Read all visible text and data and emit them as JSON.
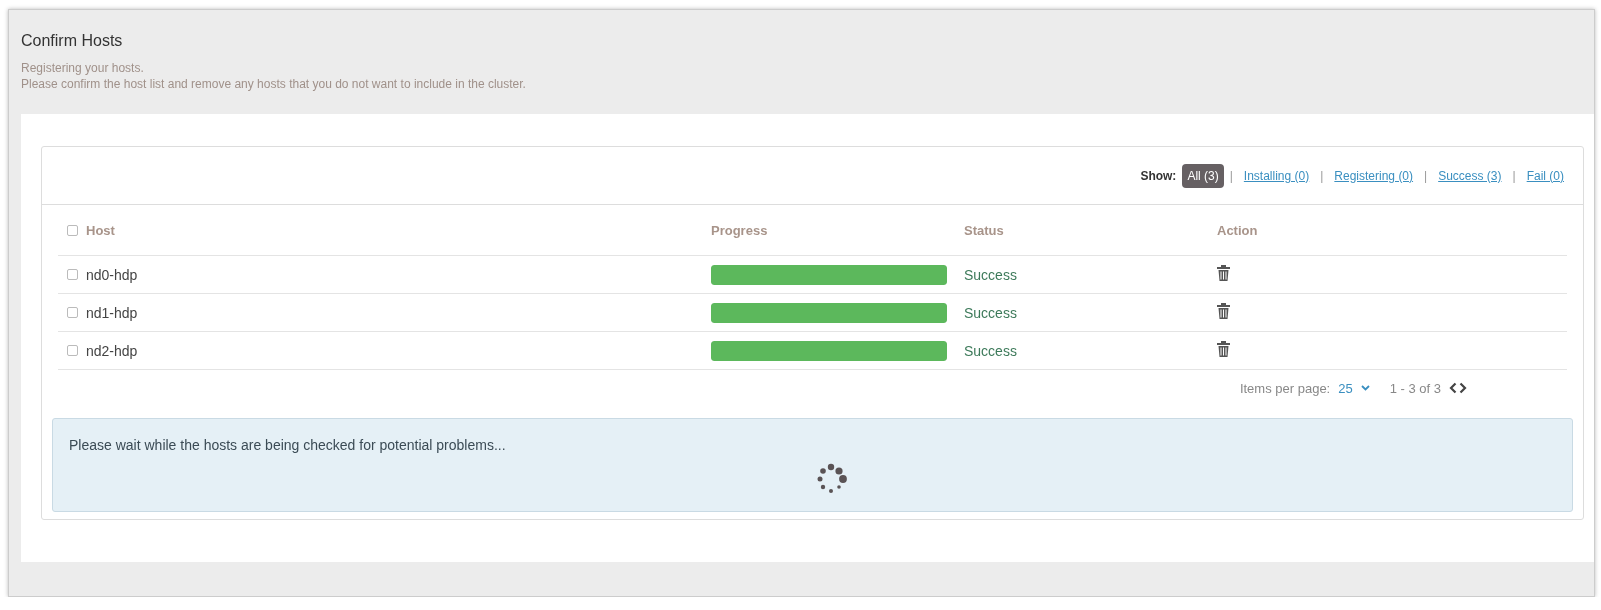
{
  "page": {
    "title": "Confirm Hosts",
    "subtitle_lines": [
      "Registering your hosts.",
      "Please confirm the host list and remove any hosts that you do not want to include in the cluster."
    ]
  },
  "filter": {
    "label": "Show:",
    "options": [
      {
        "label": "All (3)",
        "selected": true
      },
      {
        "label": "Installing (0)",
        "selected": false
      },
      {
        "label": "Registering (0)",
        "selected": false
      },
      {
        "label": "Success (3)",
        "selected": false
      },
      {
        "label": "Fail (0)",
        "selected": false
      }
    ],
    "separator": "|"
  },
  "table": {
    "select_all": {
      "checked": false
    },
    "columns": [
      "Host",
      "Progress",
      "Status",
      "Action"
    ],
    "rows": [
      {
        "checked": false,
        "host": "nd0-hdp",
        "level": 1,
        "status": "Success"
      },
      {
        "checked": false,
        "host": "nd1-hdp",
        "level": 1,
        "status": "Success"
      },
      {
        "checked": false,
        "host": "nd2-hdp",
        "level": 1,
        "status": "Success"
      }
    ]
  },
  "pagination": {
    "label": "Items per page:",
    "page_size": "25",
    "range": "1 - 3 of 3"
  },
  "alert": {
    "message": "Please wait while the hosts are being checked for potential problems..."
  }
}
